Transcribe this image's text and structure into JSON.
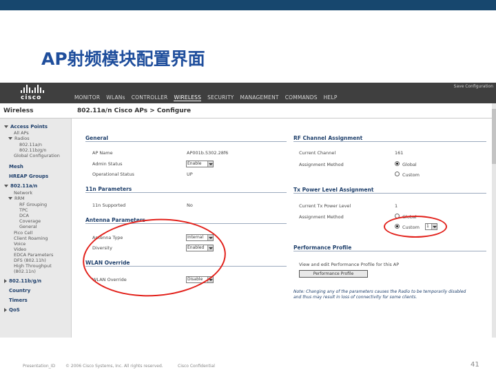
{
  "slide": {
    "title": "AP射频模块配置界面",
    "footer_left": "Presentation_ID",
    "footer_copyright": "© 2006 Cisco Systems, Inc. All rights reserved.",
    "footer_confidential": "Cisco Confidential",
    "page_number": "41"
  },
  "app": {
    "logo_text": "cisco",
    "top_right_link": "Save Configuration",
    "nav": [
      "MONITOR",
      "WLANs",
      "CONTROLLER",
      "WIRELESS",
      "SECURITY",
      "MANAGEMENT",
      "COMMANDS",
      "HELP"
    ],
    "active_nav": "WIRELESS",
    "section_title": "Wireless",
    "breadcrumb": "802.11a/n Cisco APs > Configure"
  },
  "sidebar": {
    "items": [
      "Access Points",
      "All APs",
      "Radios",
      "802.11a/n",
      "802.11b/g/n",
      "Global Configuration",
      "Mesh",
      "HREAP Groups",
      "802.11a/n",
      "Network",
      "RRM",
      "RF Grouping",
      "TPC",
      "DCA",
      "Coverage",
      "General",
      "Pico Cell",
      "Client Roaming",
      "Voice",
      "Video",
      "EDCA Parameters",
      "DFS (802.11h)",
      "High Throughput",
      "(802.11n)",
      "802.11b/g/n",
      "Country",
      "Timers",
      "QoS"
    ]
  },
  "general": {
    "heading": "General",
    "ap_name_label": "AP Name",
    "ap_name_value": "AP001b.5302.28f6",
    "admin_status_label": "Admin Status",
    "admin_status_value": "Enable",
    "operational_status_label": "Operational Status",
    "operational_status_value": "UP"
  },
  "n_params": {
    "heading": "11n Parameters",
    "supported_label": "11n Supported",
    "supported_value": "No"
  },
  "antenna": {
    "heading": "Antenna Parameters",
    "antenna_type_label": "Antenna Type",
    "antenna_type_value": "Internal",
    "diversity_label": "Diversity",
    "diversity_value": "Enabled"
  },
  "wlan_override": {
    "heading": "WLAN Override",
    "label": "WLAN Override",
    "value": "Disable"
  },
  "rf_channel": {
    "heading": "RF Channel Assignment",
    "current_channel_label": "Current Channel",
    "current_channel_value": "161",
    "assignment_method_label": "Assignment Method",
    "option_global": "Global",
    "option_custom": "Custom",
    "selected": "Global"
  },
  "tx_power": {
    "heading": "Tx Power Level Assignment",
    "current_level_label": "Current Tx Power Level",
    "current_level_value": "1",
    "assignment_method_label": "Assignment Method",
    "option_global": "Global",
    "option_custom": "Custom",
    "selected": "Custom",
    "custom_value": "1"
  },
  "performance": {
    "heading": "Performance Profile",
    "description": "View and edit Performance Profile for this AP",
    "button_label": "Performance Profile"
  },
  "note": "Note: Changing any of the parameters causes the Radio to be temporarily disabled and thus may result in loss of connectivity for some clients."
}
